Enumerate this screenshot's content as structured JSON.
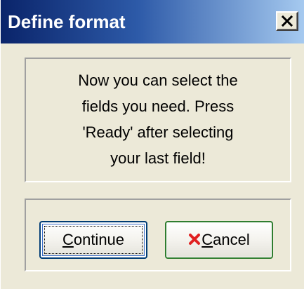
{
  "window": {
    "title": "Define format"
  },
  "message": {
    "lines": [
      "Now you can select the",
      "fields you need. Press",
      "'Ready' after selecting",
      "your last field!"
    ]
  },
  "buttons": {
    "continue": {
      "mnemonic": "C",
      "rest": "ontinue"
    },
    "cancel": {
      "mnemonic": "C",
      "rest": "ancel",
      "icon": "red-x-icon"
    }
  },
  "colors": {
    "titlebar_start": "#0a246a",
    "titlebar_end": "#a6caf0",
    "dialog_face": "#ece9d8",
    "cancel_icon": "#e02020",
    "cancel_border": "#2f7d2f"
  },
  "icons": {
    "close": "close-icon",
    "cancel": "red-x-icon"
  }
}
